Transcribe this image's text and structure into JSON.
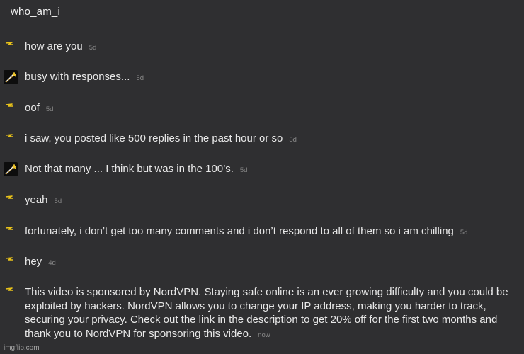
{
  "conversation": {
    "title": "who_am_i",
    "messages": [
      {
        "avatar": "bolt-avatar-icon",
        "text": "how are you",
        "time": "5d"
      },
      {
        "avatar": "shooting-star-avatar-icon",
        "text": "busy with responses...",
        "time": "5d"
      },
      {
        "avatar": "bolt-avatar-icon",
        "text": "oof",
        "time": "5d"
      },
      {
        "avatar": "bolt-avatar-icon",
        "text": "i saw, you posted like 500 replies in the past hour or so",
        "time": "5d"
      },
      {
        "avatar": "shooting-star-avatar-icon",
        "text": "Not that many ... I think but was in the 100’s.",
        "time": "5d"
      },
      {
        "avatar": "bolt-avatar-icon",
        "text": "yeah",
        "time": "5d"
      },
      {
        "avatar": "bolt-avatar-icon",
        "text": "fortunately, i don’t get too many comments and i don’t respond to all of them so i am chilling",
        "time": "5d"
      },
      {
        "avatar": "bolt-avatar-icon",
        "text": "hey",
        "time": "4d"
      },
      {
        "avatar": "bolt-avatar-icon",
        "text": "This video is sponsored by NordVPN. Staying safe online is an ever growing difficulty and you could be exploited by hackers. NordVPN allows you to change your IP address, making you harder to track, securing your privacy. Check out the link in the description to get 20% off for the first two months and thank you to NordVPN for sponsoring this video.",
        "time": "now"
      }
    ]
  },
  "watermark": "imgflip.com",
  "colors": {
    "background": "#2f2f31",
    "text": "#e8e8e8",
    "timestamp": "#8a8a8a",
    "bolt": "#e8c21a"
  }
}
